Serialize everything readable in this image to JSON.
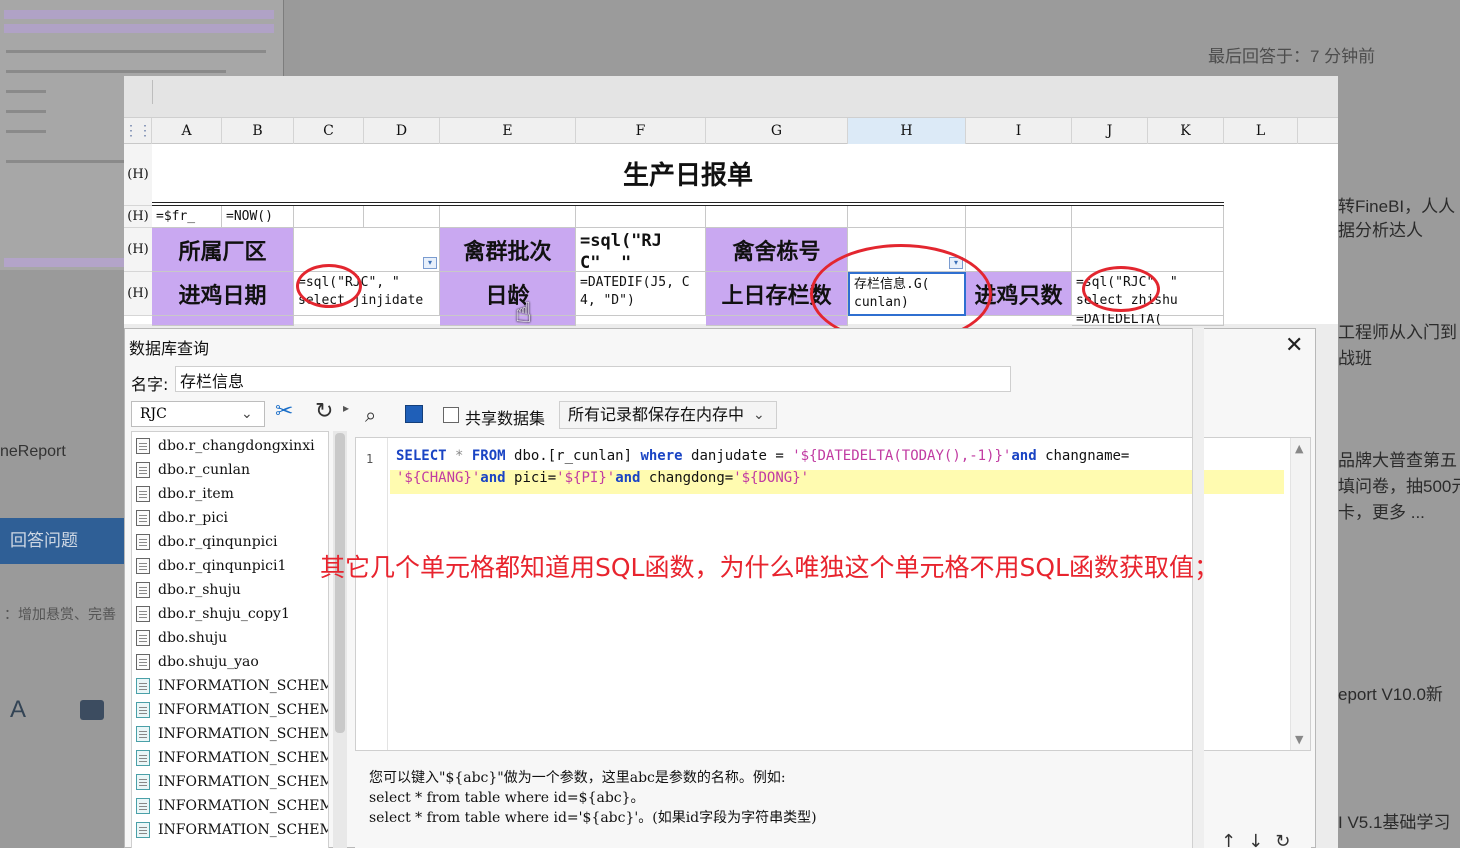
{
  "background": {
    "last_answer": "最后回答于：7 分钟前",
    "right_links": [
      "转FineBI，人人",
      "据分析达人",
      "工程师从入门到",
      "战班",
      "品牌大普查第五",
      "填问卷，抽500元",
      "卡，更多 ...",
      "eport V10.0新",
      "I V5.1基础学习"
    ],
    "left_product": "neReport",
    "answer_button": "回答问题",
    "footer_hint": "：增加悬赏、完善"
  },
  "sheet": {
    "columns": [
      "A",
      "B",
      "C",
      "D",
      "E",
      "F",
      "G",
      "H",
      "I",
      "J",
      "K",
      "L"
    ],
    "row_label": "(H)",
    "title": "生产日报单",
    "row2": {
      "a": "=$fr_",
      "c": "=NOW()"
    },
    "row3": {
      "a": "所属厂区",
      "e": "禽群批次",
      "f": "=sql(\"RJ\nC\"  \"",
      "g": "禽舍栋号"
    },
    "row4": {
      "a": "进鸡日期",
      "c": "=sql(\"RJC\", \"\nselect jinjidate",
      "e": "日龄",
      "f": "=DATEDIF(J5, C\n4, \"D\")",
      "g": "上日存栏数",
      "h": "存栏信息.G(\ncunlan)",
      "i": "进鸡只数",
      "j": "=sql(\"RJC\", \"\nselect zhishu",
      "j_next": "=DATEDELTA("
    }
  },
  "dialog": {
    "title": "数据库查询",
    "name_label": "名字:",
    "name_value": "存栏信息",
    "connection": "RJC",
    "share_label": "共享数据集",
    "memory_option": "所有记录都保存在内存中",
    "tables": [
      "dbo.r_changdongxinxi",
      "dbo.r_cunlan",
      "dbo.r_item",
      "dbo.r_pici",
      "dbo.r_qinqunpici",
      "dbo.r_qinqunpici1",
      "dbo.r_shuju",
      "dbo.r_shuju_copy1",
      "dbo.shuju",
      "dbo.shuju_yao",
      "INFORMATION_SCHEMA.CH",
      "INFORMATION_SCHEMA.CO",
      "INFORMATION_SCHEMA.CO",
      "INFORMATION_SCHEMA.CO",
      "INFORMATION_SCHEMA.CO",
      "INFORMATION_SCHEMA.CO",
      "INFORMATION_SCHEMA.DO"
    ],
    "sql": {
      "line_number": "1",
      "l1_select": "SELECT",
      "l1_star": " * ",
      "l1_from": "FROM",
      "l1_table": " dbo.[r_cunlan] ",
      "l1_where": "where",
      "l1_mid": " danjudate = ",
      "l1_str": "'${DATEDELTA(TODAY(),-1)}'",
      "l1_and": "and",
      "l1_tail": " changname=",
      "l2_str1": "'${CHANG}'",
      "l2_and1": "and",
      "l2_pici": " pici=",
      "l2_str2": "'${PI}'",
      "l2_and2": "and",
      "l2_dong": " changdong=",
      "l2_str3": "'${DONG}'"
    },
    "help": [
      "您可以键入\"${abc}\"做为一个参数，这里abc是参数的名称。例如:",
      "select * from table where id=${abc}。",
      "select * from table where id='${abc}'。(如果id字段为字符串类型)"
    ]
  },
  "annotation": "其它几个单元格都知道用SQL函数，为什么唯独这个单元格不用SQL函数获取值；",
  "colors": {
    "purple_cell": "#c9a8f1",
    "annotation_red": "#e8242e",
    "keyword_blue": "#1a44c4",
    "string_magenta": "#c13ba2"
  }
}
